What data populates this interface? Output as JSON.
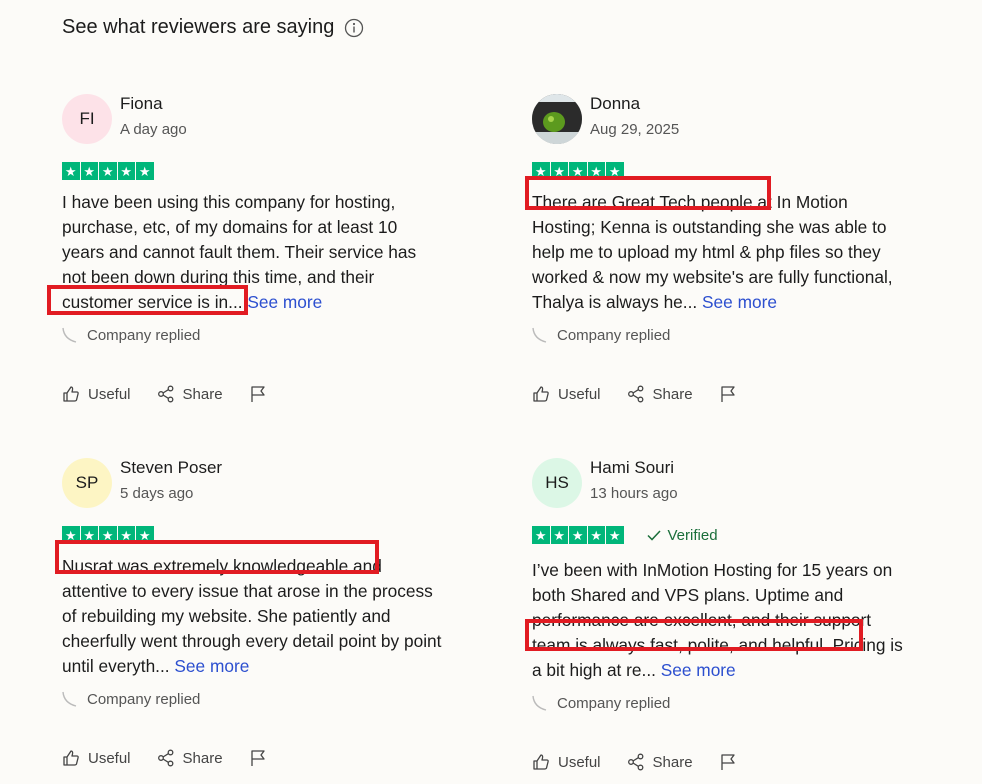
{
  "header": {
    "title": "See what reviewers are saying",
    "info_icon": "info-icon"
  },
  "reviews": [
    {
      "avatar_initials": "FI",
      "avatar_color": "#fde2e8",
      "name": "Fiona",
      "date": "A day ago",
      "rating": 5,
      "text": "I have been using this company for hosting, purchase, etc, of my domains for at least 10 years and cannot fault them. Their service has not been down during this time, and their customer service is in...",
      "see_more": "See more",
      "highlight": "customer service is in",
      "company_replied": "Company replied",
      "useful": "Useful",
      "share": "Share"
    },
    {
      "avatar_initials": "",
      "avatar_photo": "photo-avatar",
      "name": "Donna",
      "date": "Aug 29, 2025",
      "rating": 5,
      "text": "There are Great Tech people at In Motion Hosting; Kenna is outstanding she was able to help me to upload my html & php files so they worked & now my website's are fully functional, Thalya is always he...",
      "see_more": "See more",
      "highlight": "There are Great Tech people",
      "company_replied": "Company replied",
      "useful": "Useful",
      "share": "Share"
    },
    {
      "avatar_initials": "SP",
      "avatar_color": "#fdf5c4",
      "name": "Steven Poser",
      "date": "5 days ago",
      "rating": 5,
      "text": "Nusrat was extremely knowledgeable and attentive to every issue that arose in the process of rebuilding my website. She patiently and cheerfully went through every detail point by point until everyth...",
      "see_more": "See more",
      "highlight": "Nusrat was extremely knowledgeable",
      "company_replied": "Company replied",
      "useful": "Useful",
      "share": "Share"
    },
    {
      "avatar_initials": "HS",
      "avatar_color": "#dcf7e6",
      "name": "Hami Souri",
      "date": "13 hours ago",
      "rating": 5,
      "verified": "Verified",
      "text": "I’ve been with InMotion Hosting for 15 years on both Shared and VPS plans. Uptime and performance are excellent, and their support team is always fast, polite, and helpful. Pricing is a bit high at re...",
      "see_more": "See more",
      "highlight": "team is always fast, polite, and helpful.",
      "company_replied": "Company replied",
      "useful": "Useful",
      "share": "Share"
    }
  ],
  "colors": {
    "star_green": "#00b67a",
    "highlight_red": "#e11b22",
    "link_blue": "#2c4fcf"
  }
}
